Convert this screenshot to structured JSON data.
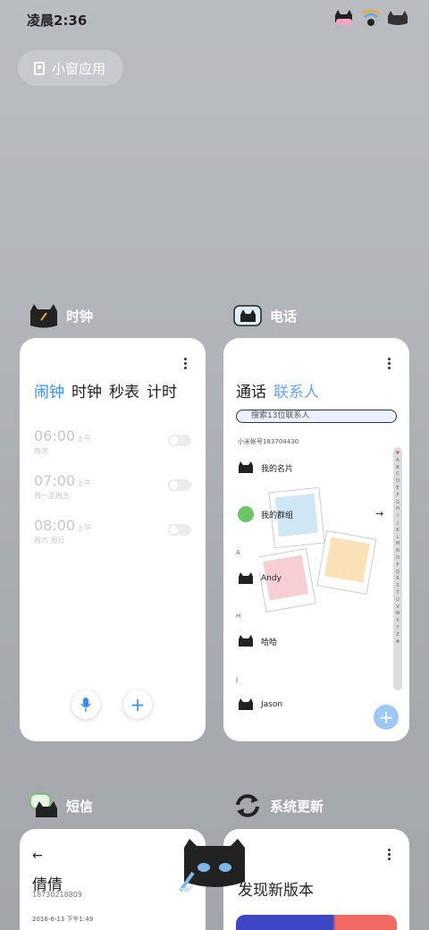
{
  "status_bar": {
    "time": "凌晨2:36"
  },
  "mini_window_button": {
    "label": "小窗应用"
  },
  "cards": {
    "clock": {
      "title": "时钟",
      "tabs": [
        "闹钟",
        "时钟",
        "秒表",
        "计时"
      ],
      "alarms": [
        {
          "time": "06:00",
          "ampm": "上午",
          "repeat": "每天",
          "enabled": false
        },
        {
          "time": "07:00",
          "ampm": "上午",
          "repeat": "周一至周五",
          "enabled": false
        },
        {
          "time": "08:00",
          "ampm": "上午",
          "repeat": "周六 周日",
          "enabled": false
        }
      ],
      "mic_icon": "microphone-icon",
      "add_icon": "plus-icon"
    },
    "phone": {
      "title": "电话",
      "tabs": [
        "通话",
        "联系人"
      ],
      "search_placeholder": "搜索13位联系人",
      "account": "小米帐号183704430",
      "contacts": [
        {
          "label": "我的名片"
        },
        {
          "label": "我的群组"
        }
      ],
      "sections": [
        {
          "letter": "A",
          "name": "Andy"
        },
        {
          "letter": "H",
          "name": "哈哈"
        },
        {
          "letter": "J",
          "name": "Jason"
        }
      ],
      "alphabet": [
        "♥",
        "A",
        "B",
        "C",
        "D",
        "E",
        "F",
        "G",
        "H",
        "I",
        "J",
        "K",
        "L",
        "M",
        "N",
        "O",
        "P",
        "Q",
        "R",
        "S",
        "T",
        "U",
        "V",
        "W",
        "X",
        "Y",
        "Z",
        "#"
      ]
    },
    "sms": {
      "title": "短信",
      "contact_name": "倩倩",
      "contact_number": "18730218809",
      "date": "2016-6-13 下午1:49"
    },
    "update": {
      "title": "系统更新",
      "headline": "发现新版本"
    }
  },
  "colors": {
    "accent": "#3a8ee8",
    "background": "#b3b6bb"
  }
}
